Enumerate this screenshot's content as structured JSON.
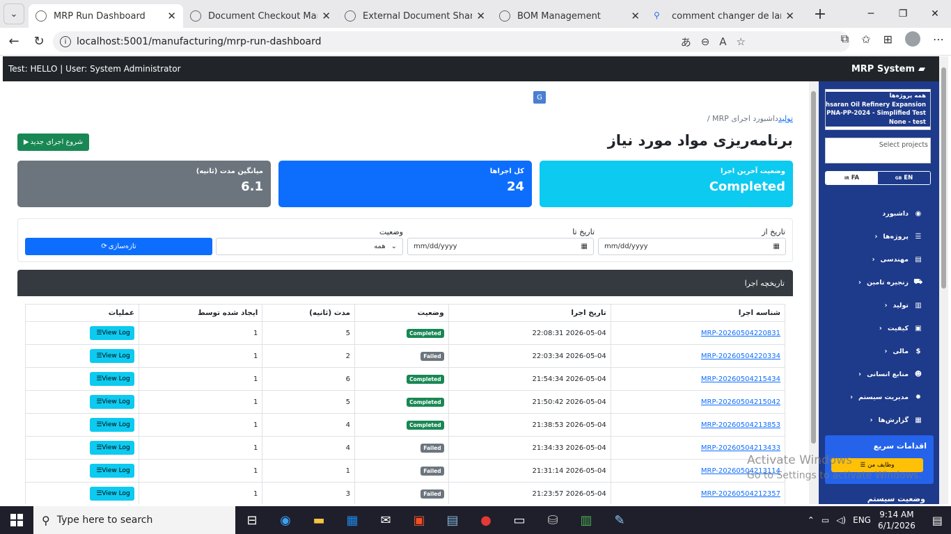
{
  "browser": {
    "tabs": [
      {
        "title": "MRP Run Dashboard",
        "active": true
      },
      {
        "title": "Document Checkout Managem",
        "active": false
      },
      {
        "title": "External Document Sharing",
        "active": false
      },
      {
        "title": "BOM Management",
        "active": false
      },
      {
        "title": "comment changer de langue s",
        "active": false
      }
    ],
    "url": "localhost:5001/manufacturing/mrp-run-dashboard"
  },
  "topbar": {
    "user_text": "Test: HELLO | User: System Administrator",
    "brand": "MRP System"
  },
  "breadcrumb": {
    "home": "تولید",
    "section": "MRP",
    "current": "داشبورد اجرای"
  },
  "page_title": "برنامه‌ریزی مواد مورد نیاز",
  "new_run_button": "شروع اجرای جدید",
  "cards": {
    "last_status": {
      "label": "وضعیت آخرین اجرا",
      "value": "Completed",
      "color": "#0dcaf0"
    },
    "total_runs": {
      "label": "کل اجراها",
      "value": "24",
      "color": "#0d6efd"
    },
    "avg_duration": {
      "label": "میانگین مدت (ثانیه)",
      "value": "6.1",
      "color": "#6c757d"
    }
  },
  "filters": {
    "date_from_label": "تاریخ از",
    "date_to_label": "تاریخ تا",
    "status_label": "وضعیت",
    "date_placeholder": "mm/dd/yyyy",
    "status_value": "همه",
    "refresh_button": "تازه‌سازی"
  },
  "history": {
    "title": "تاریخچه اجرا",
    "columns": [
      "شناسه اجرا",
      "تاریخ اجرا",
      "وضعیت",
      "مدت (ثانیه)",
      "ایجاد شده توسط",
      "عملیات"
    ],
    "log_button": "View Log",
    "rows": [
      {
        "id": "MRP-20260504220831",
        "date": "2026-05-04 22:08:31",
        "status": "Completed",
        "duration": "5",
        "created_by": "1"
      },
      {
        "id": "MRP-20260504220334",
        "date": "2026-05-04 22:03:34",
        "status": "Failed",
        "duration": "2",
        "created_by": "1"
      },
      {
        "id": "MRP-20260504215434",
        "date": "2026-05-04 21:54:34",
        "status": "Completed",
        "duration": "6",
        "created_by": "1"
      },
      {
        "id": "MRP-20260504215042",
        "date": "2026-05-04 21:50:42",
        "status": "Completed",
        "duration": "5",
        "created_by": "1"
      },
      {
        "id": "MRP-20260504213853",
        "date": "2026-05-04 21:38:53",
        "status": "Completed",
        "duration": "4",
        "created_by": "1"
      },
      {
        "id": "MRP-20260504213433",
        "date": "2026-05-04 21:34:33",
        "status": "Failed",
        "duration": "4",
        "created_by": "1"
      },
      {
        "id": "MRP-20260504213114",
        "date": "2026-05-04 21:31:14",
        "status": "Failed",
        "duration": "1",
        "created_by": "1"
      },
      {
        "id": "MRP-20260504212357",
        "date": "2026-05-04 21:23:57",
        "status": "Failed",
        "duration": "3",
        "created_by": "1"
      }
    ]
  },
  "sidebar": {
    "projects": [
      "همه پروژه‌ها",
      "chsaran Oil Refinery Expansion",
      "PNA-PP-2024 - Simplified Test",
      "None - test"
    ],
    "project_placeholder": "Select projects",
    "lang_fa": "FA",
    "lang_en": "EN",
    "nav": [
      {
        "label": "داشبورد",
        "icon": "dashboard-icon",
        "glyph": "◉"
      },
      {
        "label": "پروژه‌ها",
        "icon": "list-icon",
        "glyph": "☰"
      },
      {
        "label": "مهندسی",
        "icon": "file-icon",
        "glyph": "▤"
      },
      {
        "label": "زنجیره تامین",
        "icon": "truck-icon",
        "glyph": "⛟"
      },
      {
        "label": "تولید",
        "icon": "industry-icon",
        "glyph": "▥"
      },
      {
        "label": "کیفیت",
        "icon": "clipboard-icon",
        "glyph": "▣"
      },
      {
        "label": "مالی",
        "icon": "dollar-icon",
        "glyph": "$"
      },
      {
        "label": "منابع انسانی",
        "icon": "users-icon",
        "glyph": "☻"
      },
      {
        "label": "مدیریت سیستم",
        "icon": "cog-icon",
        "glyph": "✹"
      },
      {
        "label": "گزارش‌ها",
        "icon": "chart-icon",
        "glyph": "▦"
      }
    ],
    "quick_title": "اقدامات سریع",
    "quick_button": "وظایف من",
    "system_status": "وضعیت سیستم"
  },
  "watermark": {
    "line1": "Activate Windows",
    "line2": "Go to Settings to activate Windows."
  },
  "taskbar": {
    "search_placeholder": "Type here to search",
    "lang": "ENG",
    "time": "9:14 AM",
    "date": "6/1/2026"
  }
}
